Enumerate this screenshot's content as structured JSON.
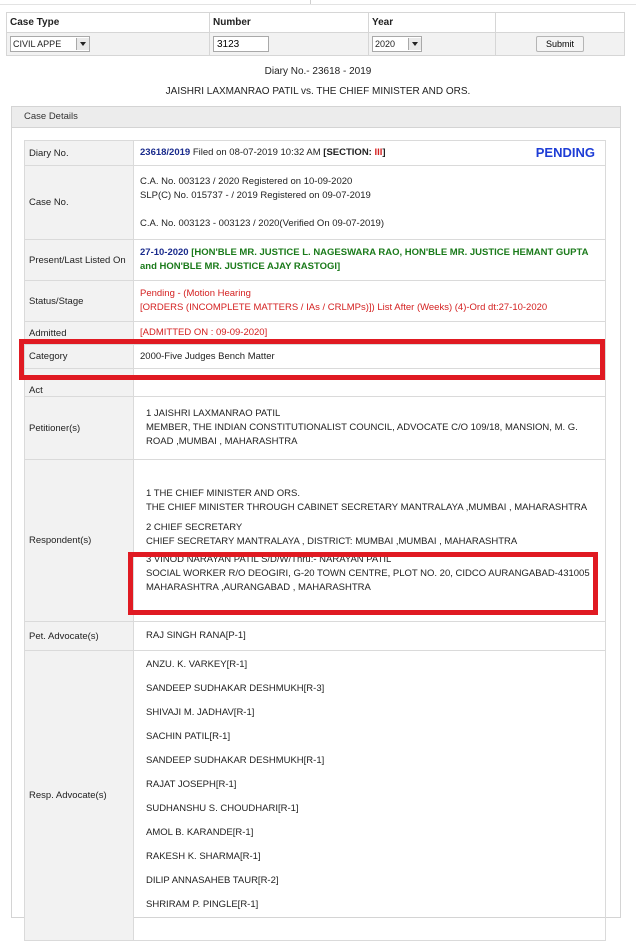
{
  "search": {
    "headers": [
      "Case Type",
      "Number",
      "Year",
      ""
    ],
    "case_type": "CIVIL APPE",
    "number": "3123",
    "year": "2020",
    "submit_label": "Submit"
  },
  "heading": {
    "diary_line": "Diary No.- 23618 - 2019",
    "parties_line": "JAISHRI LAXMANRAO PATIL vs. THE CHIEF MINISTER AND ORS."
  },
  "panel_title": "Case Details",
  "details": {
    "diary": {
      "label": "Diary No.",
      "number": "23618/2019",
      "filed": " Filed on 08-07-2019 10:32 AM ",
      "section_prefix": "[SECTION: ",
      "section_value": "III",
      "section_suffix": "]",
      "status_badge": "PENDING"
    },
    "case_no": {
      "label": "Case No.",
      "line1": "C.A. No. 003123 / 2020  Registered on 10-09-2020",
      "line2": "SLP(C) No. 015737 - / 2019  Registered on 09-07-2019",
      "line3": "C.A. No. 003123 - 003123 / 2020(Verified On 09-07-2019)"
    },
    "listed": {
      "label": "Present/Last Listed On",
      "date": "27-10-2020",
      "bench": " [HON'BLE MR. JUSTICE L. NAGESWARA RAO, HON'BLE MR. JUSTICE HEMANT GUPTA and HON'BLE MR. JUSTICE AJAY RASTOGI]"
    },
    "status": {
      "label": "Status/Stage",
      "line1": "Pending - (Motion Hearing",
      "line2": "[ORDERS (INCOMPLETE MATTERS / IAs / CRLMPs)]) List After (Weeks) (4)-Ord dt:27-10-2020"
    },
    "admitted": {
      "label": "Admitted",
      "value": "[ADMITTED ON : 09-09-2020]"
    },
    "category": {
      "label": "Category",
      "value": "2000-Five Judges Bench Matter"
    },
    "act": {
      "label": "Act",
      "value": ""
    },
    "petitioner": {
      "label": "Petitioner(s)",
      "name": "1 JAISHRI LAXMANRAO PATIL",
      "address": "MEMBER, THE INDIAN CONSTITUTIONALIST COUNCIL, ADVOCATE C/O 109/18, MANSION, M. G. ROAD ,MUMBAI , MAHARASHTRA"
    },
    "respondents": {
      "label": "Respondent(s)",
      "items": [
        {
          "name": "1 THE CHIEF MINISTER AND ORS.",
          "address": "THE CHIEF MINISTER THROUGH CABINET SECRETARY MANTRALAYA ,MUMBAI , MAHARASHTRA"
        },
        {
          "name": "2 CHIEF SECRETARY",
          "address": "CHIEF SECRETARY MANTRALAYA , DISTRICT: MUMBAI ,MUMBAI , MAHARASHTRA"
        },
        {
          "name": "3 VINOD NARAYAN PATIL S/D/W/Thru:- NARAYAN PATIL",
          "address": "SOCIAL WORKER R/O DEOGIRI, G-20 TOWN CENTRE, PLOT NO. 20, CIDCO AURANGABAD-431005 MAHARASHTRA ,AURANGABAD , MAHARASHTRA"
        }
      ]
    },
    "pet_advocate": {
      "label": "Pet. Advocate(s)",
      "value": "RAJ SINGH RANA[P-1]"
    },
    "resp_advocates": {
      "label": "Resp. Advocate(s)",
      "items": [
        "ANZU. K. VARKEY[R-1]",
        "SANDEEP SUDHAKAR DESHMUKH[R-3]",
        "SHIVAJI M. JADHAV[R-1]",
        "SACHIN PATIL[R-1]",
        "SANDEEP SUDHAKAR DESHMUKH[R-1]",
        "RAJAT JOSEPH[R-1]",
        "SUDHANSHU S. CHOUDHARI[R-1]",
        "AMOL B. KARANDE[R-1]",
        "RAKESH K. SHARMA[R-1]",
        "DILIP ANNASAHEB TAUR[R-2]",
        "SHRIRAM P. PINGLE[R-1]"
      ]
    }
  },
  "colors": {
    "highlight": "#e01a22",
    "pending": "#1e3dd6",
    "diary_link": "#1a2b8c",
    "status_red": "#d42121",
    "bench_green": "#1a7a1a",
    "label_bg": "#f2f2f2"
  }
}
